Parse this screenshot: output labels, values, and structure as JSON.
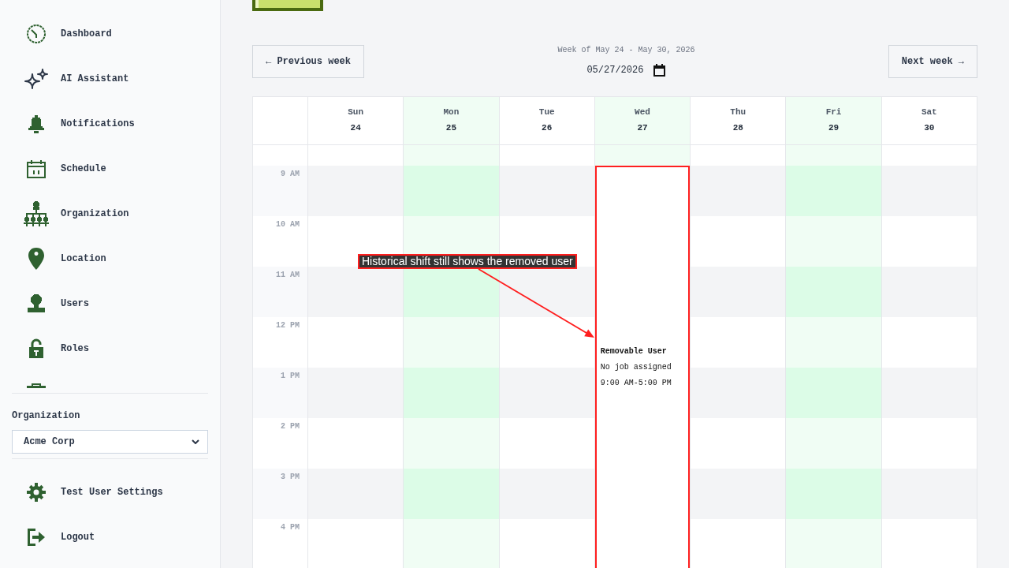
{
  "sidebar": {
    "nav_items": [
      {
        "label": "Dashboard"
      },
      {
        "label": "AI Assistant"
      },
      {
        "label": "Notifications"
      },
      {
        "label": "Schedule"
      },
      {
        "label": "Organization"
      },
      {
        "label": "Location"
      },
      {
        "label": "Users"
      },
      {
        "label": "Roles"
      }
    ],
    "organization": {
      "label": "Organization",
      "value": "Acme Corp"
    },
    "footer_items": [
      {
        "label": "Test User Settings"
      },
      {
        "label": "Logout"
      }
    ]
  },
  "week_nav": {
    "previous": "← Previous week",
    "title": "Week of May 24 - May 30, 2026",
    "date": "05/27/2026",
    "next": "Next week →"
  },
  "calendar": {
    "days": [
      {
        "weekday": "Sun",
        "date": "24",
        "highlighted": false
      },
      {
        "weekday": "Mon",
        "date": "25",
        "highlighted": true
      },
      {
        "weekday": "Tue",
        "date": "26",
        "highlighted": false
      },
      {
        "weekday": "Wed",
        "date": "27",
        "highlighted": true,
        "shifts": [
          {
            "name": "Removable User",
            "job": "No job assigned",
            "time": "9:00 AM-5:00 PM"
          }
        ]
      },
      {
        "weekday": "Thu",
        "date": "28",
        "highlighted": false
      },
      {
        "weekday": "Fri",
        "date": "29",
        "highlighted": true
      },
      {
        "weekday": "Sat",
        "date": "30",
        "highlighted": false
      }
    ],
    "hours": [
      "9 AM",
      "10 AM",
      "11 AM",
      "12 PM",
      "1 PM",
      "2 PM",
      "3 PM",
      "4 PM"
    ]
  },
  "annotation": {
    "callout": "Historical shift still shows the removed user"
  }
}
